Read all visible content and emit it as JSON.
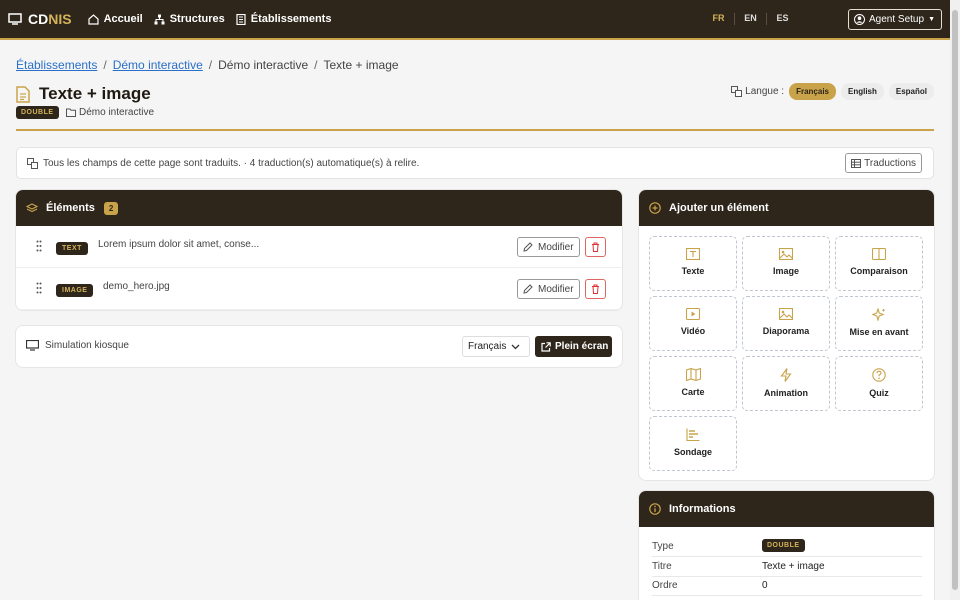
{
  "topbar": {
    "brand_cd": "CD",
    "brand_nis": "NIS",
    "nav": [
      "Accueil",
      "Structures",
      "Établissements"
    ],
    "languages": [
      "FR",
      "EN",
      "ES"
    ],
    "active_language": "FR",
    "user_button": "Agent Setup",
    "colors": {
      "bar": "#2e261b",
      "accent": "#c9a34a"
    }
  },
  "breadcrumb": {
    "link1": "Établissements",
    "link2": "Démo interactive",
    "crumb3": "Démo interactive",
    "current": "Texte + image",
    "separator": "/"
  },
  "page": {
    "title": "Texte + image",
    "type_badge": "DOUBLE",
    "folder": "Démo interactive"
  },
  "language_switch": {
    "label": "Langue :",
    "options": [
      "Français",
      "English",
      "Español"
    ],
    "selected": "Français"
  },
  "notice": {
    "text": "Tous les champs de cette page sont traduits. · 4 traduction(s) automatique(s) à relire.",
    "button": "Traductions"
  },
  "elements": {
    "title": "Éléments",
    "count": "2",
    "items": [
      {
        "type": "TEXT",
        "text": "Lorem ipsum dolor sit amet, conse...",
        "edit": "Modifier"
      },
      {
        "type": "IMAGE",
        "text": "demo_hero.jpg",
        "edit": "Modifier"
      }
    ]
  },
  "kiosk": {
    "label": "Simulation kiosque",
    "language": "Français",
    "fullscreen": "Plein écran"
  },
  "add_element": {
    "title": "Ajouter un élément",
    "tiles": [
      {
        "label": "Texte",
        "icon": "text-icon"
      },
      {
        "label": "Image",
        "icon": "image-icon"
      },
      {
        "label": "Comparaison",
        "icon": "comparison-icon"
      },
      {
        "label": "Vidéo",
        "icon": "video-icon"
      },
      {
        "label": "Diaporama",
        "icon": "slideshow-icon"
      },
      {
        "label": "Mise en avant",
        "icon": "sparkle-icon"
      },
      {
        "label": "Carte",
        "icon": "map-icon"
      },
      {
        "label": "Animation",
        "icon": "lightning-icon"
      },
      {
        "label": "Quiz",
        "icon": "question-icon"
      },
      {
        "label": "Sondage",
        "icon": "poll-icon"
      }
    ]
  },
  "info": {
    "title": "Informations",
    "rows": [
      {
        "key": "Type",
        "value": "DOUBLE"
      },
      {
        "key": "Titre",
        "value": "Texte + image"
      },
      {
        "key": "Ordre",
        "value": "0"
      }
    ]
  }
}
